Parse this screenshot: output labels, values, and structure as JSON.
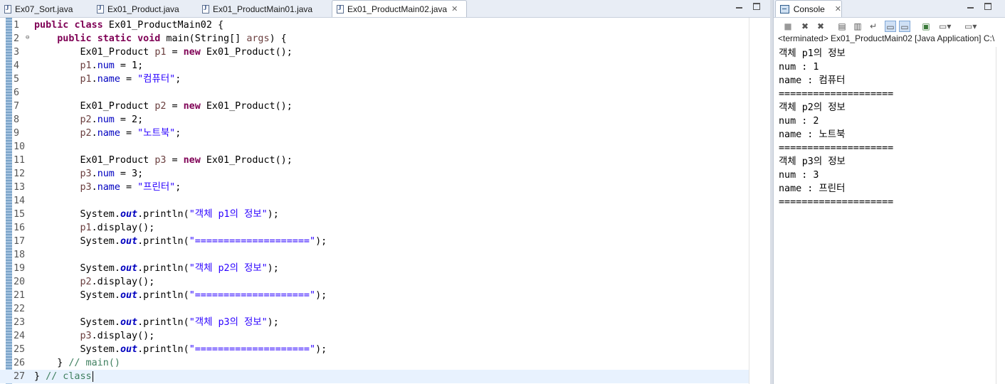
{
  "editor": {
    "tabs": [
      {
        "label": "Ex07_Sort.java",
        "active": false
      },
      {
        "label": "Ex01_Product.java",
        "active": false
      },
      {
        "label": "Ex01_ProductMain01.java",
        "active": false
      },
      {
        "label": "Ex01_ProductMain02.java",
        "active": true,
        "close": "✕"
      }
    ],
    "current_line": 27,
    "lines": [
      {
        "n": "1",
        "tokens": [
          {
            "t": "public",
            "c": "kw"
          },
          {
            "t": " "
          },
          {
            "t": "class",
            "c": "kw"
          },
          {
            "t": " Ex01_ProductMain02 {"
          }
        ]
      },
      {
        "n": "2",
        "fold": "⊖",
        "tokens": [
          {
            "t": "    "
          },
          {
            "t": "public",
            "c": "kw"
          },
          {
            "t": " "
          },
          {
            "t": "static",
            "c": "kw"
          },
          {
            "t": " "
          },
          {
            "t": "void",
            "c": "kw"
          },
          {
            "t": " main(String[] "
          },
          {
            "t": "args",
            "c": "var"
          },
          {
            "t": ") {"
          }
        ]
      },
      {
        "n": "3",
        "tokens": [
          {
            "t": "        Ex01_Product "
          },
          {
            "t": "p1",
            "c": "var"
          },
          {
            "t": " = "
          },
          {
            "t": "new",
            "c": "kw"
          },
          {
            "t": " Ex01_Product();"
          }
        ]
      },
      {
        "n": "4",
        "tokens": [
          {
            "t": "        "
          },
          {
            "t": "p1",
            "c": "var"
          },
          {
            "t": "."
          },
          {
            "t": "num",
            "c": "fld"
          },
          {
            "t": " = 1;"
          }
        ]
      },
      {
        "n": "5",
        "tokens": [
          {
            "t": "        "
          },
          {
            "t": "p1",
            "c": "var"
          },
          {
            "t": "."
          },
          {
            "t": "name",
            "c": "fld"
          },
          {
            "t": " = "
          },
          {
            "t": "\"컴퓨터\"",
            "c": "str"
          },
          {
            "t": ";"
          }
        ]
      },
      {
        "n": "6",
        "tokens": []
      },
      {
        "n": "7",
        "tokens": [
          {
            "t": "        Ex01_Product "
          },
          {
            "t": "p2",
            "c": "var"
          },
          {
            "t": " = "
          },
          {
            "t": "new",
            "c": "kw"
          },
          {
            "t": " Ex01_Product();"
          }
        ]
      },
      {
        "n": "8",
        "tokens": [
          {
            "t": "        "
          },
          {
            "t": "p2",
            "c": "var"
          },
          {
            "t": "."
          },
          {
            "t": "num",
            "c": "fld"
          },
          {
            "t": " = 2;"
          }
        ]
      },
      {
        "n": "9",
        "tokens": [
          {
            "t": "        "
          },
          {
            "t": "p2",
            "c": "var"
          },
          {
            "t": "."
          },
          {
            "t": "name",
            "c": "fld"
          },
          {
            "t": " = "
          },
          {
            "t": "\"노트북\"",
            "c": "str"
          },
          {
            "t": ";"
          }
        ]
      },
      {
        "n": "10",
        "tokens": []
      },
      {
        "n": "11",
        "tokens": [
          {
            "t": "        Ex01_Product "
          },
          {
            "t": "p3",
            "c": "var"
          },
          {
            "t": " = "
          },
          {
            "t": "new",
            "c": "kw"
          },
          {
            "t": " Ex01_Product();"
          }
        ]
      },
      {
        "n": "12",
        "tokens": [
          {
            "t": "        "
          },
          {
            "t": "p3",
            "c": "var"
          },
          {
            "t": "."
          },
          {
            "t": "num",
            "c": "fld"
          },
          {
            "t": " = 3;"
          }
        ]
      },
      {
        "n": "13",
        "tokens": [
          {
            "t": "        "
          },
          {
            "t": "p3",
            "c": "var"
          },
          {
            "t": "."
          },
          {
            "t": "name",
            "c": "fld"
          },
          {
            "t": " = "
          },
          {
            "t": "\"프린터\"",
            "c": "str"
          },
          {
            "t": ";"
          }
        ]
      },
      {
        "n": "14",
        "tokens": []
      },
      {
        "n": "15",
        "tokens": [
          {
            "t": "        System."
          },
          {
            "t": "out",
            "c": "sfld"
          },
          {
            "t": ".println("
          },
          {
            "t": "\"객체 p1의 정보\"",
            "c": "str"
          },
          {
            "t": ");"
          }
        ]
      },
      {
        "n": "16",
        "tokens": [
          {
            "t": "        "
          },
          {
            "t": "p1",
            "c": "var"
          },
          {
            "t": ".display();"
          }
        ]
      },
      {
        "n": "17",
        "tokens": [
          {
            "t": "        System."
          },
          {
            "t": "out",
            "c": "sfld"
          },
          {
            "t": ".println("
          },
          {
            "t": "\"====================\"",
            "c": "str"
          },
          {
            "t": ");"
          }
        ]
      },
      {
        "n": "18",
        "tokens": []
      },
      {
        "n": "19",
        "tokens": [
          {
            "t": "        System."
          },
          {
            "t": "out",
            "c": "sfld"
          },
          {
            "t": ".println("
          },
          {
            "t": "\"객체 p2의 정보\"",
            "c": "str"
          },
          {
            "t": ");"
          }
        ]
      },
      {
        "n": "20",
        "tokens": [
          {
            "t": "        "
          },
          {
            "t": "p2",
            "c": "var"
          },
          {
            "t": ".display();"
          }
        ]
      },
      {
        "n": "21",
        "tokens": [
          {
            "t": "        System."
          },
          {
            "t": "out",
            "c": "sfld"
          },
          {
            "t": ".println("
          },
          {
            "t": "\"====================\"",
            "c": "str"
          },
          {
            "t": ");"
          }
        ]
      },
      {
        "n": "22",
        "tokens": []
      },
      {
        "n": "23",
        "tokens": [
          {
            "t": "        System."
          },
          {
            "t": "out",
            "c": "sfld"
          },
          {
            "t": ".println("
          },
          {
            "t": "\"객체 p3의 정보\"",
            "c": "str"
          },
          {
            "t": ");"
          }
        ]
      },
      {
        "n": "24",
        "tokens": [
          {
            "t": "        "
          },
          {
            "t": "p3",
            "c": "var"
          },
          {
            "t": ".display();"
          }
        ]
      },
      {
        "n": "25",
        "tokens": [
          {
            "t": "        System."
          },
          {
            "t": "out",
            "c": "sfld"
          },
          {
            "t": ".println("
          },
          {
            "t": "\"====================\"",
            "c": "str"
          },
          {
            "t": ");"
          }
        ]
      },
      {
        "n": "26",
        "tokens": [
          {
            "t": "    } "
          },
          {
            "t": "// main()",
            "c": "cmt"
          }
        ]
      },
      {
        "n": "27",
        "tokens": [
          {
            "t": "} "
          },
          {
            "t": "// class",
            "c": "cmt"
          }
        ]
      }
    ]
  },
  "console": {
    "tab_label": "Console",
    "tab_close": "✕",
    "title": "<terminated> Ex01_ProductMain02 [Java Application] C:\\",
    "output": [
      "객체 p1의 정보",
      "num : 1",
      "name : 컴퓨터",
      "====================",
      "객체 p2의 정보",
      "num : 2",
      "name : 노트북",
      "====================",
      "객체 p3의 정보",
      "num : 3",
      "name : 프린터",
      "===================="
    ],
    "toolbar": [
      "stop-icon",
      "remove-launch-icon",
      "remove-all-icon",
      "clear-console-icon",
      "scroll-lock-icon",
      "word-wrap-icon",
      "show-on-output-icon",
      "show-on-error-icon",
      "pin-console-icon",
      "display-console-icon",
      "open-console-icon"
    ]
  },
  "colors": {
    "keyword": "#7f0055",
    "string": "#2a00ff",
    "comment": "#3f7f5f",
    "field": "#0000c0",
    "local": "#6a3e3e",
    "current_line": "#e8f2fe"
  }
}
